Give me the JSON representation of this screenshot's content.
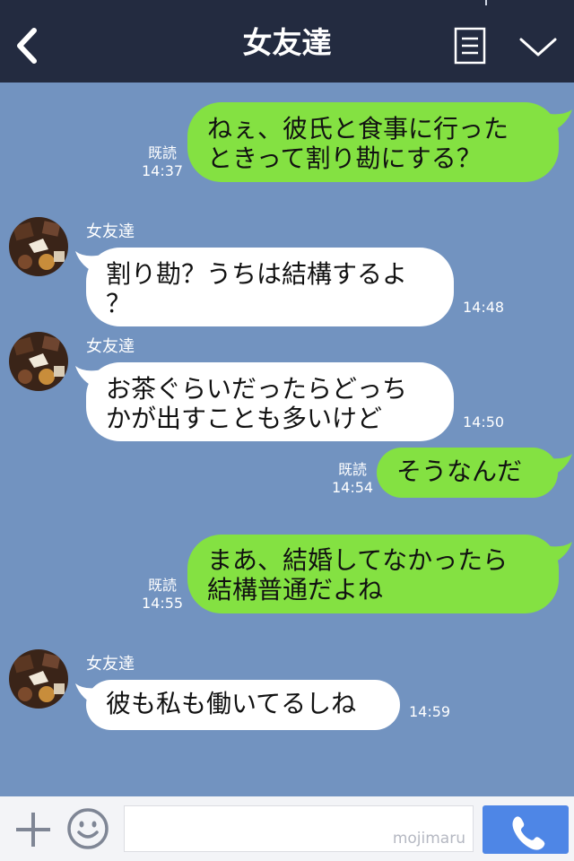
{
  "header": {
    "title": "女友達",
    "back_icon": "chevron-left-icon",
    "menu_icon": "menu-icon",
    "collapse_icon": "chevron-down-icon"
  },
  "messages": [
    {
      "from": "me",
      "text": "ねぇ、彼氏と食事に行った\nときって割り勘にする？",
      "read": "既読",
      "time": "14:37"
    },
    {
      "from": "friend",
      "sender": "女友達",
      "text": "割り勘？うちは結構するよ\n？",
      "time": "14:48"
    },
    {
      "from": "friend",
      "sender": "女友達",
      "text": "お茶ぐらいだったらどっち\nかが出すことも多いけど",
      "time": "14:50"
    },
    {
      "from": "me",
      "text": "そうなんだ",
      "read": "既読",
      "time": "14:54"
    },
    {
      "from": "me",
      "text": "まあ、結婚してなかったら\n結構普通だよね",
      "read": "既読",
      "time": "14:55"
    },
    {
      "from": "friend",
      "sender": "女友達",
      "text": "彼も私も働いてるしね",
      "time": "14:59"
    }
  ],
  "bottom_bar": {
    "plus_icon": "plus-icon",
    "emoji_icon": "smiley-icon",
    "watermark": "mojimaru",
    "call_icon": "phone-icon"
  },
  "colors": {
    "header_bg": "#232b40",
    "chat_bg": "#7293c0",
    "my_bubble": "#84e142",
    "friend_bubble": "#ffffff",
    "call_button": "#4e86e6"
  }
}
